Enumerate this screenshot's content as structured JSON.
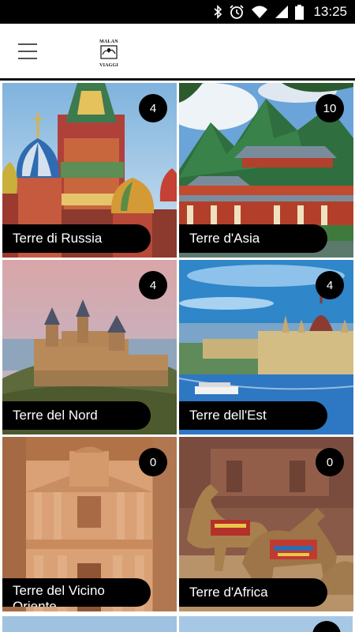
{
  "status_bar": {
    "time": "13:25",
    "icons": [
      "bluetooth-icon",
      "alarm-icon",
      "wifi-icon",
      "signal-icon",
      "battery-icon"
    ]
  },
  "app_bar": {
    "menu_icon": "hamburger-menu-icon",
    "logo_lines": [
      "MALAN",
      "VIAGGI"
    ]
  },
  "destinations": [
    {
      "title": "Terre di Russia",
      "count": "4"
    },
    {
      "title": "Terre d'Asia",
      "count": "10"
    },
    {
      "title": "Terre del Nord",
      "count": "4"
    },
    {
      "title": "Terre dell'Est",
      "count": "4"
    },
    {
      "title": "Terre del Vicino Oriente",
      "count": "0"
    },
    {
      "title": "Terre d'Africa",
      "count": "0"
    }
  ],
  "colors": {
    "status_bar": "#000000",
    "badge": "#000000",
    "label_bg": "#000000",
    "label_text": "#ffffff"
  }
}
